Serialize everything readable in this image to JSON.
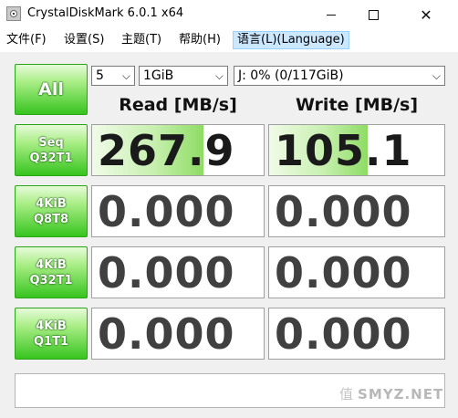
{
  "window": {
    "title": "CrystalDiskMark 6.0.1 x64",
    "minimize_glyph": "—",
    "maximize_glyph": "☐",
    "close_glyph": "✕"
  },
  "menu": {
    "file": "文件(F)",
    "settings": "设置(S)",
    "theme": "主题(T)",
    "help": "帮助(H)",
    "language": "语言(L)(Language)"
  },
  "controls": {
    "all_label": "All",
    "count": "5",
    "size": "1GiB",
    "drive": "J: 0% (0/117GiB)",
    "chevron": "⌵"
  },
  "headers": {
    "read": "Read [MB/s]",
    "write": "Write [MB/s]"
  },
  "tests": [
    {
      "line1": "Seq",
      "line2": "Q32T1",
      "read": "267.9",
      "write": "105.1",
      "read_fill_pct": 65,
      "write_fill_pct": 56
    },
    {
      "line1": "4KiB",
      "line2": "Q8T8",
      "read": "0.000",
      "write": "0.000",
      "read_fill_pct": 0,
      "write_fill_pct": 0
    },
    {
      "line1": "4KiB",
      "line2": "Q32T1",
      "read": "0.000",
      "write": "0.000",
      "read_fill_pct": 0,
      "write_fill_pct": 0
    },
    {
      "line1": "4KiB",
      "line2": "Q1T1",
      "read": "0.000",
      "write": "0.000",
      "read_fill_pct": 0,
      "write_fill_pct": 0
    }
  ],
  "comment": "",
  "watermark": {
    "glyph": "值",
    "text": "SMYZ.NET"
  }
}
